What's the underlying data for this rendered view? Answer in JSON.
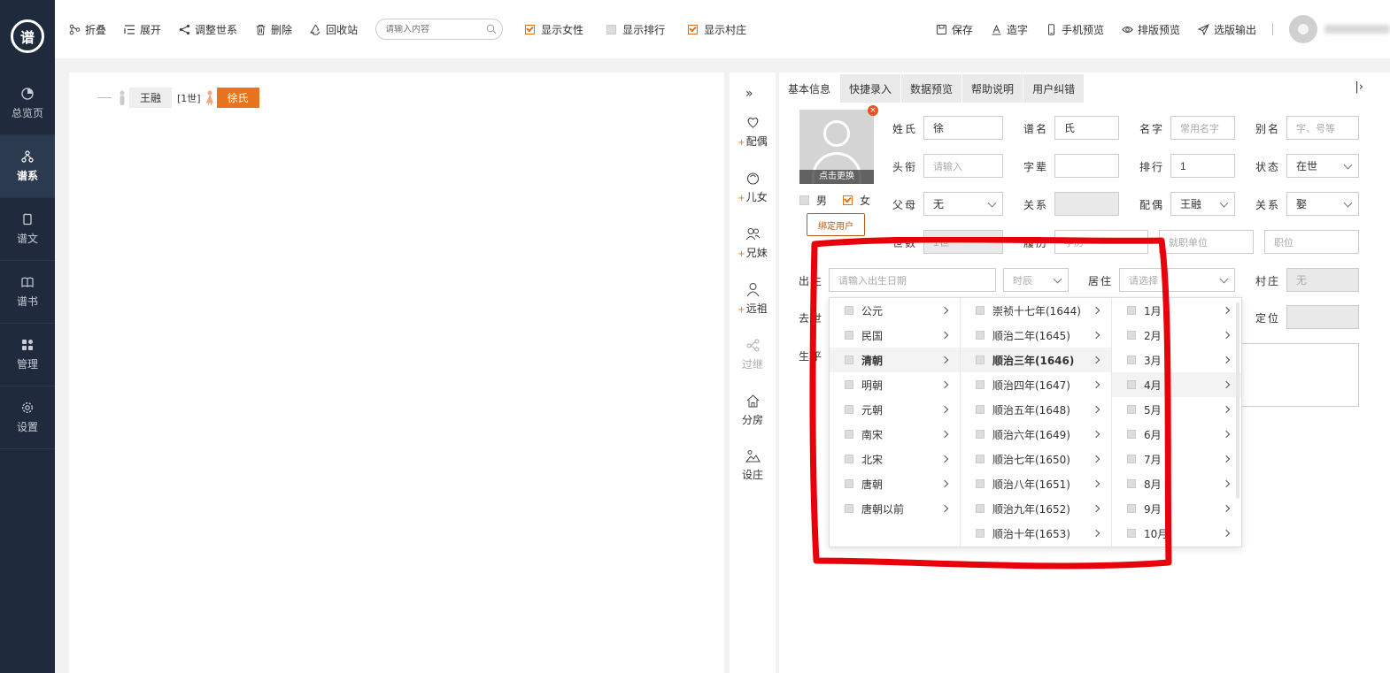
{
  "sidebar": {
    "logo_text": "谱",
    "items": [
      {
        "label": "总览页",
        "icon": "pie-icon"
      },
      {
        "label": "谱系",
        "icon": "tree-icon",
        "active": true
      },
      {
        "label": "谱文",
        "icon": "doc-icon"
      },
      {
        "label": "谱书",
        "icon": "book-icon"
      },
      {
        "label": "管理",
        "icon": "grid-icon"
      },
      {
        "label": "设置",
        "icon": "gear-icon"
      }
    ]
  },
  "toolbar": {
    "collapse": "折叠",
    "expand": "展开",
    "adjust": "调整世系",
    "delete": "删除",
    "recycle": "回收站",
    "search_placeholder": "请输入内容",
    "show_female": "显示女性",
    "show_rank": "显示排行",
    "show_village": "显示村庄",
    "save": "保存",
    "make_char": "造字",
    "mobile_preview": "手机预览",
    "layout_preview": "排版预览",
    "export": "选版输出"
  },
  "tree": {
    "person": "王融",
    "generation": "[1世]",
    "spouse": "徐氏"
  },
  "relations": {
    "spouse": "配偶",
    "children": "儿女",
    "siblings": "兄妹",
    "ancestor": "远祖",
    "adopt": "过继",
    "branch": "分房",
    "village": "设庄"
  },
  "tabs": [
    "基本信息",
    "快捷录入",
    "数据预览",
    "帮助说明",
    "用户纠错"
  ],
  "form": {
    "photo_caption": "点击更换",
    "male": "男",
    "female": "女",
    "bind_user": "绑定用户",
    "surname_label": "姓氏",
    "surname": "徐",
    "pu_name_label": "谱名",
    "pu_name": "氏",
    "given_label": "名字",
    "given_ph": "常用名字",
    "alias_label": "别名",
    "alias_ph": "字、号等",
    "title_label": "头衔",
    "title_ph": "请输入",
    "zibei_label": "字辈",
    "rank_label": "排行",
    "rank": "1",
    "status_label": "状态",
    "status": "在世",
    "parent_label": "父母",
    "parent": "无",
    "relation_label": "关系",
    "spouse_label": "配偶",
    "spouse": "王融",
    "relation2_label": "关系",
    "relation2": "娶",
    "gen_label": "世数",
    "gen": "1世",
    "resume_label": "履历",
    "resume_ph": "学历",
    "unit_ph": "就职单位",
    "post_ph": "职位",
    "birth_label": "出生",
    "birth_ph": "请输入出生日期",
    "shichen_ph": "时辰",
    "live_label": "居住",
    "live_ph": "请选择",
    "village_label": "村庄",
    "village": "无",
    "death_label": "去世",
    "locate_label": "定位",
    "life_label": "生平"
  },
  "cascader": {
    "eras": [
      "公元",
      "民国",
      "清朝",
      "明朝",
      "元朝",
      "南宋",
      "北宋",
      "唐朝",
      "唐朝以前"
    ],
    "years": [
      "崇祯十七年(1644)",
      "顺治二年(1645)",
      "顺治三年(1646)",
      "顺治四年(1647)",
      "顺治五年(1648)",
      "顺治六年(1649)",
      "顺治七年(1650)",
      "顺治八年(1651)",
      "顺治九年(1652)",
      "顺治十年(1653)"
    ],
    "months": [
      "1月",
      "2月",
      "3月",
      "4月",
      "5月",
      "6月",
      "7月",
      "8月",
      "9月",
      "10月"
    ],
    "selected_era": "清朝",
    "selected_year": "顺治三年(1646)",
    "hover_month": "4月"
  },
  "colors": {
    "accent": "#e8741f",
    "sidebar_bg": "#1f2b3d",
    "annotation": "#e8000b"
  }
}
